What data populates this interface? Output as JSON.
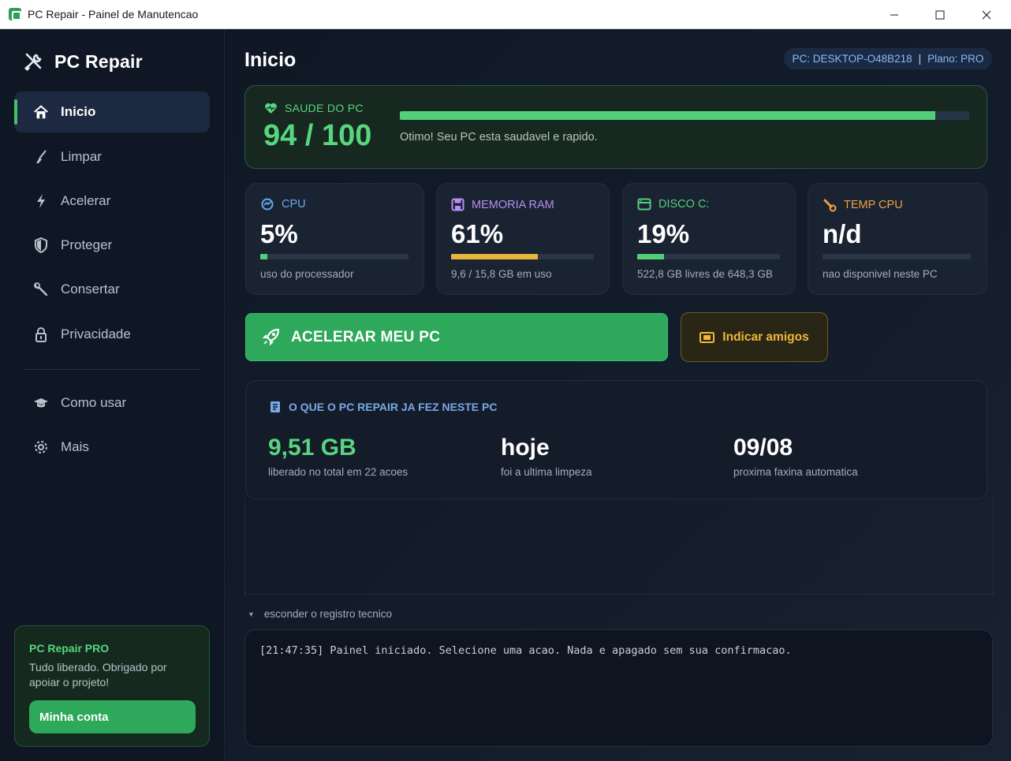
{
  "window": {
    "title": "PC Repair - Painel de Manutencao",
    "controls": [
      "minimize-icon",
      "maximize-icon",
      "close-icon"
    ]
  },
  "sidebar": {
    "brand": "PC Repair",
    "items": [
      {
        "label": "Inicio",
        "icon": "home-icon",
        "active": true
      },
      {
        "label": "Limpar",
        "icon": "broom-icon"
      },
      {
        "label": "Acelerar",
        "icon": "bolt-icon"
      },
      {
        "label": "Proteger",
        "icon": "shield-icon"
      },
      {
        "label": "Consertar",
        "icon": "wrench-icon"
      },
      {
        "label": "Privacidade",
        "icon": "lock-icon"
      },
      {
        "label": "Como usar",
        "icon": "graduation-cap-icon"
      },
      {
        "label": "Mais",
        "icon": "gear-icon"
      }
    ],
    "pro_card": {
      "title": "PC Repair PRO",
      "text": "Tudo liberado. Obrigado por apoiar o projeto!",
      "button": "Minha conta"
    }
  },
  "header": {
    "title": "Inicio",
    "pc_label": "PC: DESKTOP-O48B218",
    "separator": "|",
    "plan_label": "Plano: PRO"
  },
  "health": {
    "label": "SAUDE DO PC",
    "score": "94 / 100",
    "percent": 94,
    "message": "Otimo! Seu PC esta saudavel e rapido."
  },
  "stats": [
    {
      "label": "CPU",
      "value": "5%",
      "percent": 5,
      "note": "uso do processador",
      "color": "#6aa8f0",
      "bar_color": "#53cf79",
      "icon": "cpu-icon"
    },
    {
      "label": "MEMORIA RAM",
      "value": "61%",
      "percent": 61,
      "note": "9,6 / 15,8 GB em uso",
      "color": "#b78ff0",
      "bar_color": "#e6b53c",
      "icon": "memory-icon"
    },
    {
      "label": "DISCO C:",
      "value": "19%",
      "percent": 19,
      "note": "522,8 GB livres de 648,3 GB",
      "color": "#53cf79",
      "bar_color": "#53cf79",
      "icon": "disk-icon"
    },
    {
      "label": "TEMP CPU",
      "value": "n/d",
      "percent": 0,
      "note": "nao disponivel neste PC",
      "color": "#f0a040",
      "bar_color": "#53cf79",
      "icon": "thermometer-icon"
    }
  ],
  "actions": {
    "boost": "ACELERAR MEU PC",
    "refer": "Indicar amigos"
  },
  "history": {
    "title": "O QUE O PC REPAIR JA FEZ NESTE PC",
    "items": [
      {
        "value": "9,51 GB",
        "label": "liberado no total em 22 acoes"
      },
      {
        "value": "hoje",
        "label": "foi a ultima limpeza"
      },
      {
        "value": "09/08",
        "label": "proxima faxina automatica"
      }
    ]
  },
  "log": {
    "toggle": "esconder o registro tecnico",
    "lines": [
      "[21:47:35] Painel iniciado. Selecione uma acao. Nada e apagado sem sua confirmacao."
    ]
  },
  "colors": {
    "accent_green": "#2ea85a",
    "score_green": "#56d67e",
    "gold": "#f0b73b",
    "link_blue": "#78a9e8"
  }
}
